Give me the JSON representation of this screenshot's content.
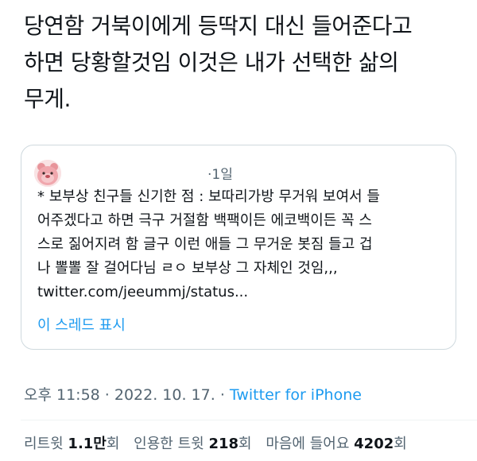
{
  "tweet": {
    "lines": [
      "당연함 거북이에게 등딱지 대신 들어준다고",
      "하면 당황할것임 이것은 내가 선택한 삶의",
      "무게."
    ]
  },
  "quote": {
    "avatar_icon": "pink-character-avatar-icon",
    "time": "·1일",
    "lines": [
      "* 보부상 친구들 신기한 점 : 보따리가방 무거워 보여서 들",
      "어주겠다고 하면 극구 거절함 백팩이든 에코백이든 꼭 스",
      "스로 짊어지려 함 글구 이런 애들 그 무거운 봇짐 들고 겁",
      "나 뽈뽈 잘 걸어다님 ㄹㅇ 보부상 그 자체인 것임,,,",
      "twitter.com/jeeummj/status..."
    ],
    "show_thread": "이 스레드 표시"
  },
  "meta": {
    "timestamp": "오후 11:58 · 2022. 10. 17. · ",
    "source": "Twitter for iPhone"
  },
  "stats": {
    "retweets_label": "리트윗",
    "retweets_count": "1.1만",
    "retweets_suffix": "회",
    "quotes_label": "인용한 트윗",
    "quotes_count": "218",
    "quotes_suffix": "회",
    "likes_label": "마음에 들어요",
    "likes_count": "4202",
    "likes_suffix": "회"
  },
  "colors": {
    "text": "#0f1419",
    "secondary": "#536471",
    "link": "#1d9bf0",
    "border": "#cfd9de"
  }
}
